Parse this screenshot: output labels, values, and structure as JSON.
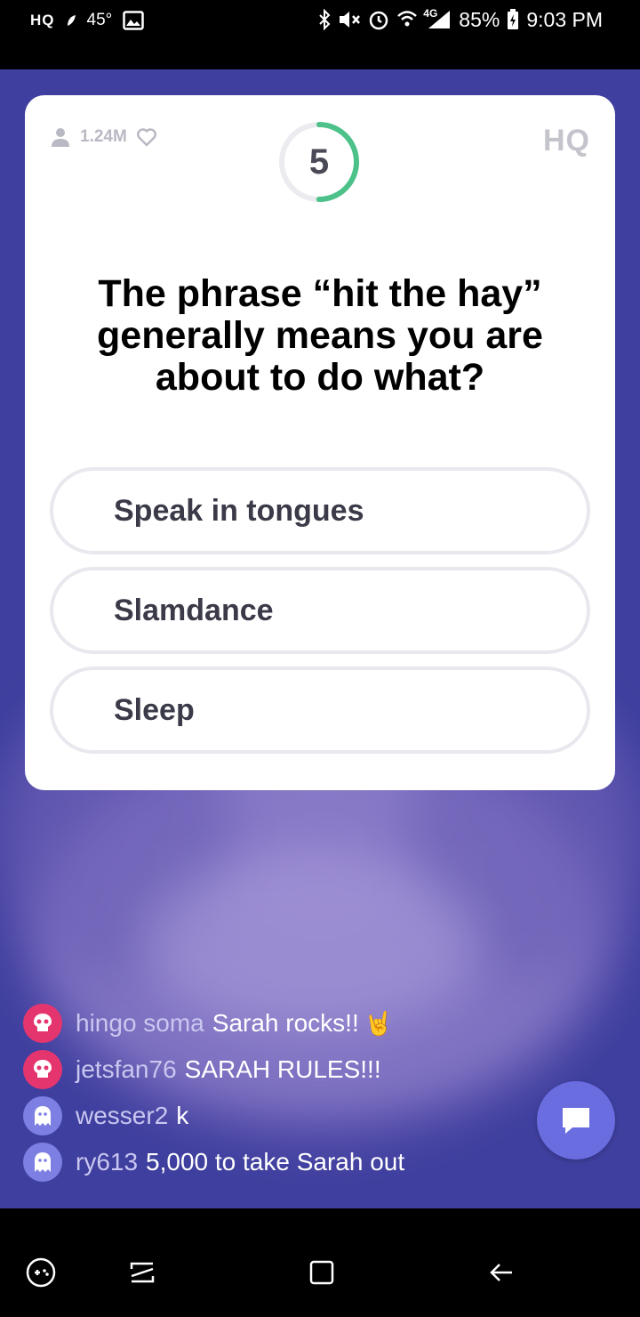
{
  "status_bar": {
    "app_indicator": "HQ",
    "temperature": "45°",
    "battery_percent": "85%",
    "time": "9:03 PM",
    "network": "4G"
  },
  "card": {
    "viewer_count": "1.24M",
    "logo": "HQ",
    "timer_value": "5",
    "timer_progress_fraction": 0.5,
    "question": "The phrase “hit the hay” generally means you are about to do what?",
    "answers": [
      {
        "label": "Speak in tongues"
      },
      {
        "label": "Slamdance"
      },
      {
        "label": "Sleep"
      }
    ]
  },
  "chat": {
    "messages": [
      {
        "user": "hingo soma",
        "message": "Sarah rocks!!",
        "emoji": "🤘",
        "avatar_color": "#e5356f"
      },
      {
        "user": "jetsfan76",
        "message": "SARAH RULES!!!",
        "avatar_color": "#e5356f"
      },
      {
        "user": "wesser2",
        "message": "k",
        "avatar_color": "#7d7fe2"
      },
      {
        "user": "ry613",
        "message": "5,000 to take Sarah out",
        "avatar_color": "#7d7fe2"
      }
    ]
  },
  "colors": {
    "timer_accent": "#4cc28a",
    "card_background": "#ffffff",
    "chat_button": "#6a6de0"
  }
}
